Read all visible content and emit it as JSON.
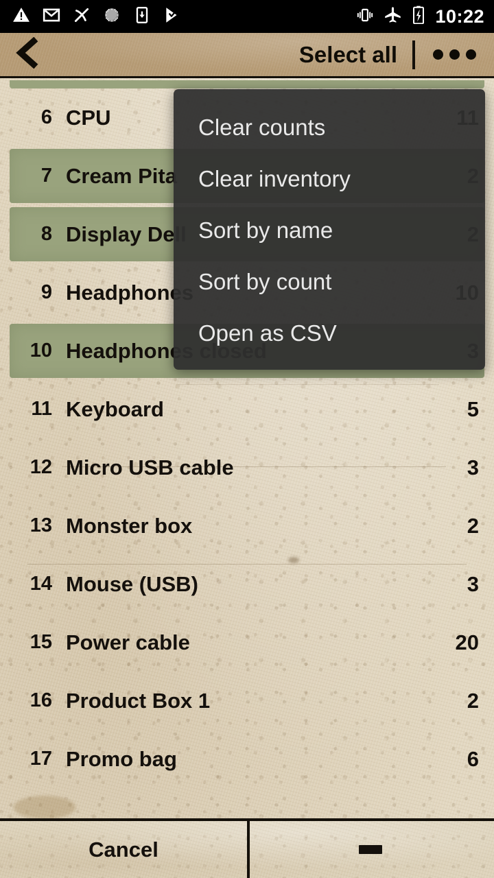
{
  "status_bar": {
    "icons": [
      {
        "name": "warning-triangle-icon"
      },
      {
        "name": "gmail-mail-icon"
      },
      {
        "name": "pickaxe-tool-icon"
      },
      {
        "name": "sun-brightness-icon"
      },
      {
        "name": "download-to-phone-icon"
      },
      {
        "name": "checkmark-flag-icon"
      }
    ],
    "right_icons": [
      {
        "name": "vibrate-icon"
      },
      {
        "name": "airplane-mode-icon"
      },
      {
        "name": "battery-charging-icon"
      }
    ],
    "clock": "10:22"
  },
  "action_bar": {
    "back_icon": "chevron-left-icon",
    "title": "Select all",
    "overflow_icon": "overflow-dots-icon"
  },
  "popup_menu": {
    "items": [
      "Clear counts",
      "Clear inventory",
      "Sort by name",
      "Sort by count",
      "Open as CSV"
    ]
  },
  "list": {
    "rows": [
      {
        "index": "6",
        "name": "CPU",
        "count": "11",
        "selected": false
      },
      {
        "index": "7",
        "name": "Cream Pita",
        "count": "2",
        "selected": true
      },
      {
        "index": "8",
        "name": "Display Dell",
        "count": "2",
        "selected": true
      },
      {
        "index": "9",
        "name": "Headphones",
        "count": "10",
        "selected": false
      },
      {
        "index": "10",
        "name": "Headphones closed",
        "count": "3",
        "selected": true
      },
      {
        "index": "11",
        "name": "Keyboard",
        "count": "5",
        "selected": false
      },
      {
        "index": "12",
        "name": "Micro USB cable",
        "count": "3",
        "selected": false
      },
      {
        "index": "13",
        "name": "Monster box",
        "count": "2",
        "selected": false
      },
      {
        "index": "14",
        "name": "Mouse (USB)",
        "count": "3",
        "selected": false
      },
      {
        "index": "15",
        "name": "Power cable",
        "count": "20",
        "selected": false
      },
      {
        "index": "16",
        "name": "Product Box 1",
        "count": "2",
        "selected": false
      },
      {
        "index": "17",
        "name": "Promo bag",
        "count": "6",
        "selected": false
      }
    ]
  },
  "bottom_bar": {
    "cancel_label": "Cancel",
    "minus_icon": "minus-icon"
  },
  "colors": {
    "paper_background": "#e2d7c0",
    "action_bar": "#b69b75",
    "selected_row": "#99a37d",
    "menu_background": "#2f2f2f",
    "menu_text": "#e9e9e9",
    "text": "#14100c",
    "status_bar": "#000000"
  }
}
